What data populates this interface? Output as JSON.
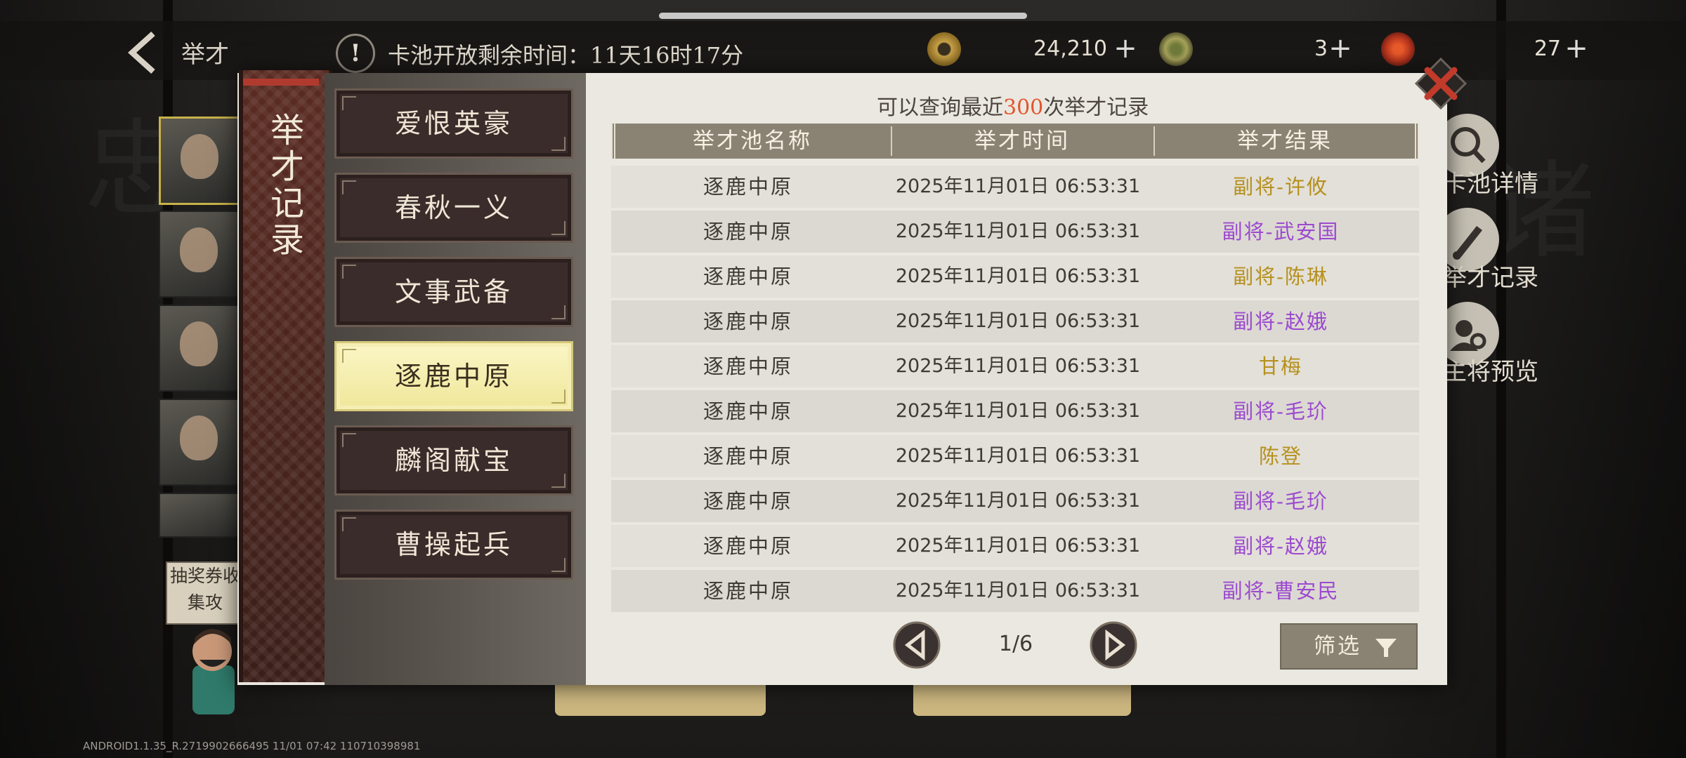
{
  "top_bar": {
    "back_label": "举才",
    "notice_icon": "!",
    "notice_text": "卡池开放剩余时间：11天16时17分",
    "currencies": [
      {
        "icon": "copper-coin-icon",
        "value": "24,210",
        "plus": "+"
      },
      {
        "icon": "jade-token-icon",
        "value": "3",
        "plus": "+"
      },
      {
        "icon": "red-token-icon",
        "value": "27",
        "plus": "+"
      }
    ]
  },
  "left_panel": {
    "lottery_card_text": "抽奖券收集攻",
    "build_info": "ANDROID1.1.35_R.2719902666495 11/01 07:42 110710398981"
  },
  "side_buttons": [
    {
      "label": "卡池详情",
      "icon": "magnifier-icon"
    },
    {
      "label": "举才记录",
      "icon": "brush-icon"
    },
    {
      "label": "主将预览",
      "icon": "person-search-icon"
    }
  ],
  "modal": {
    "banner_title": "举才记录",
    "tabs": [
      {
        "label": "爱恨英豪",
        "active": false
      },
      {
        "label": "春秋一义",
        "active": false
      },
      {
        "label": "文事武备",
        "active": false
      },
      {
        "label": "逐鹿中原",
        "active": true
      },
      {
        "label": "麟阁献宝",
        "active": false
      },
      {
        "label": "曹操起兵",
        "active": false
      }
    ],
    "note_prefix": "可以查询最近",
    "note_number": "300",
    "note_suffix": "次举才记录",
    "table": {
      "columns": [
        "举才池名称",
        "举才时间",
        "举才结果"
      ],
      "rows": [
        {
          "pool": "逐鹿中原",
          "time": "2025年11月01日 06:53:31",
          "result": "副将-许攸",
          "color": "gold"
        },
        {
          "pool": "逐鹿中原",
          "time": "2025年11月01日 06:53:31",
          "result": "副将-武安国",
          "color": "purple"
        },
        {
          "pool": "逐鹿中原",
          "time": "2025年11月01日 06:53:31",
          "result": "副将-陈琳",
          "color": "gold"
        },
        {
          "pool": "逐鹿中原",
          "time": "2025年11月01日 06:53:31",
          "result": "副将-赵娥",
          "color": "purple"
        },
        {
          "pool": "逐鹿中原",
          "time": "2025年11月01日 06:53:31",
          "result": "甘梅",
          "color": "gold"
        },
        {
          "pool": "逐鹿中原",
          "time": "2025年11月01日 06:53:31",
          "result": "副将-毛玠",
          "color": "purple"
        },
        {
          "pool": "逐鹿中原",
          "time": "2025年11月01日 06:53:31",
          "result": "陈登",
          "color": "gold"
        },
        {
          "pool": "逐鹿中原",
          "time": "2025年11月01日 06:53:31",
          "result": "副将-毛玠",
          "color": "purple"
        },
        {
          "pool": "逐鹿中原",
          "time": "2025年11月01日 06:53:31",
          "result": "副将-赵娥",
          "color": "purple"
        },
        {
          "pool": "逐鹿中原",
          "time": "2025年11月01日 06:53:31",
          "result": "副将-曹安民",
          "color": "purple"
        }
      ]
    },
    "pagination": "1/6",
    "filter_label": "筛选",
    "result_colors": {
      "gold": "#b6911e",
      "purple": "#9c4ad0"
    }
  }
}
